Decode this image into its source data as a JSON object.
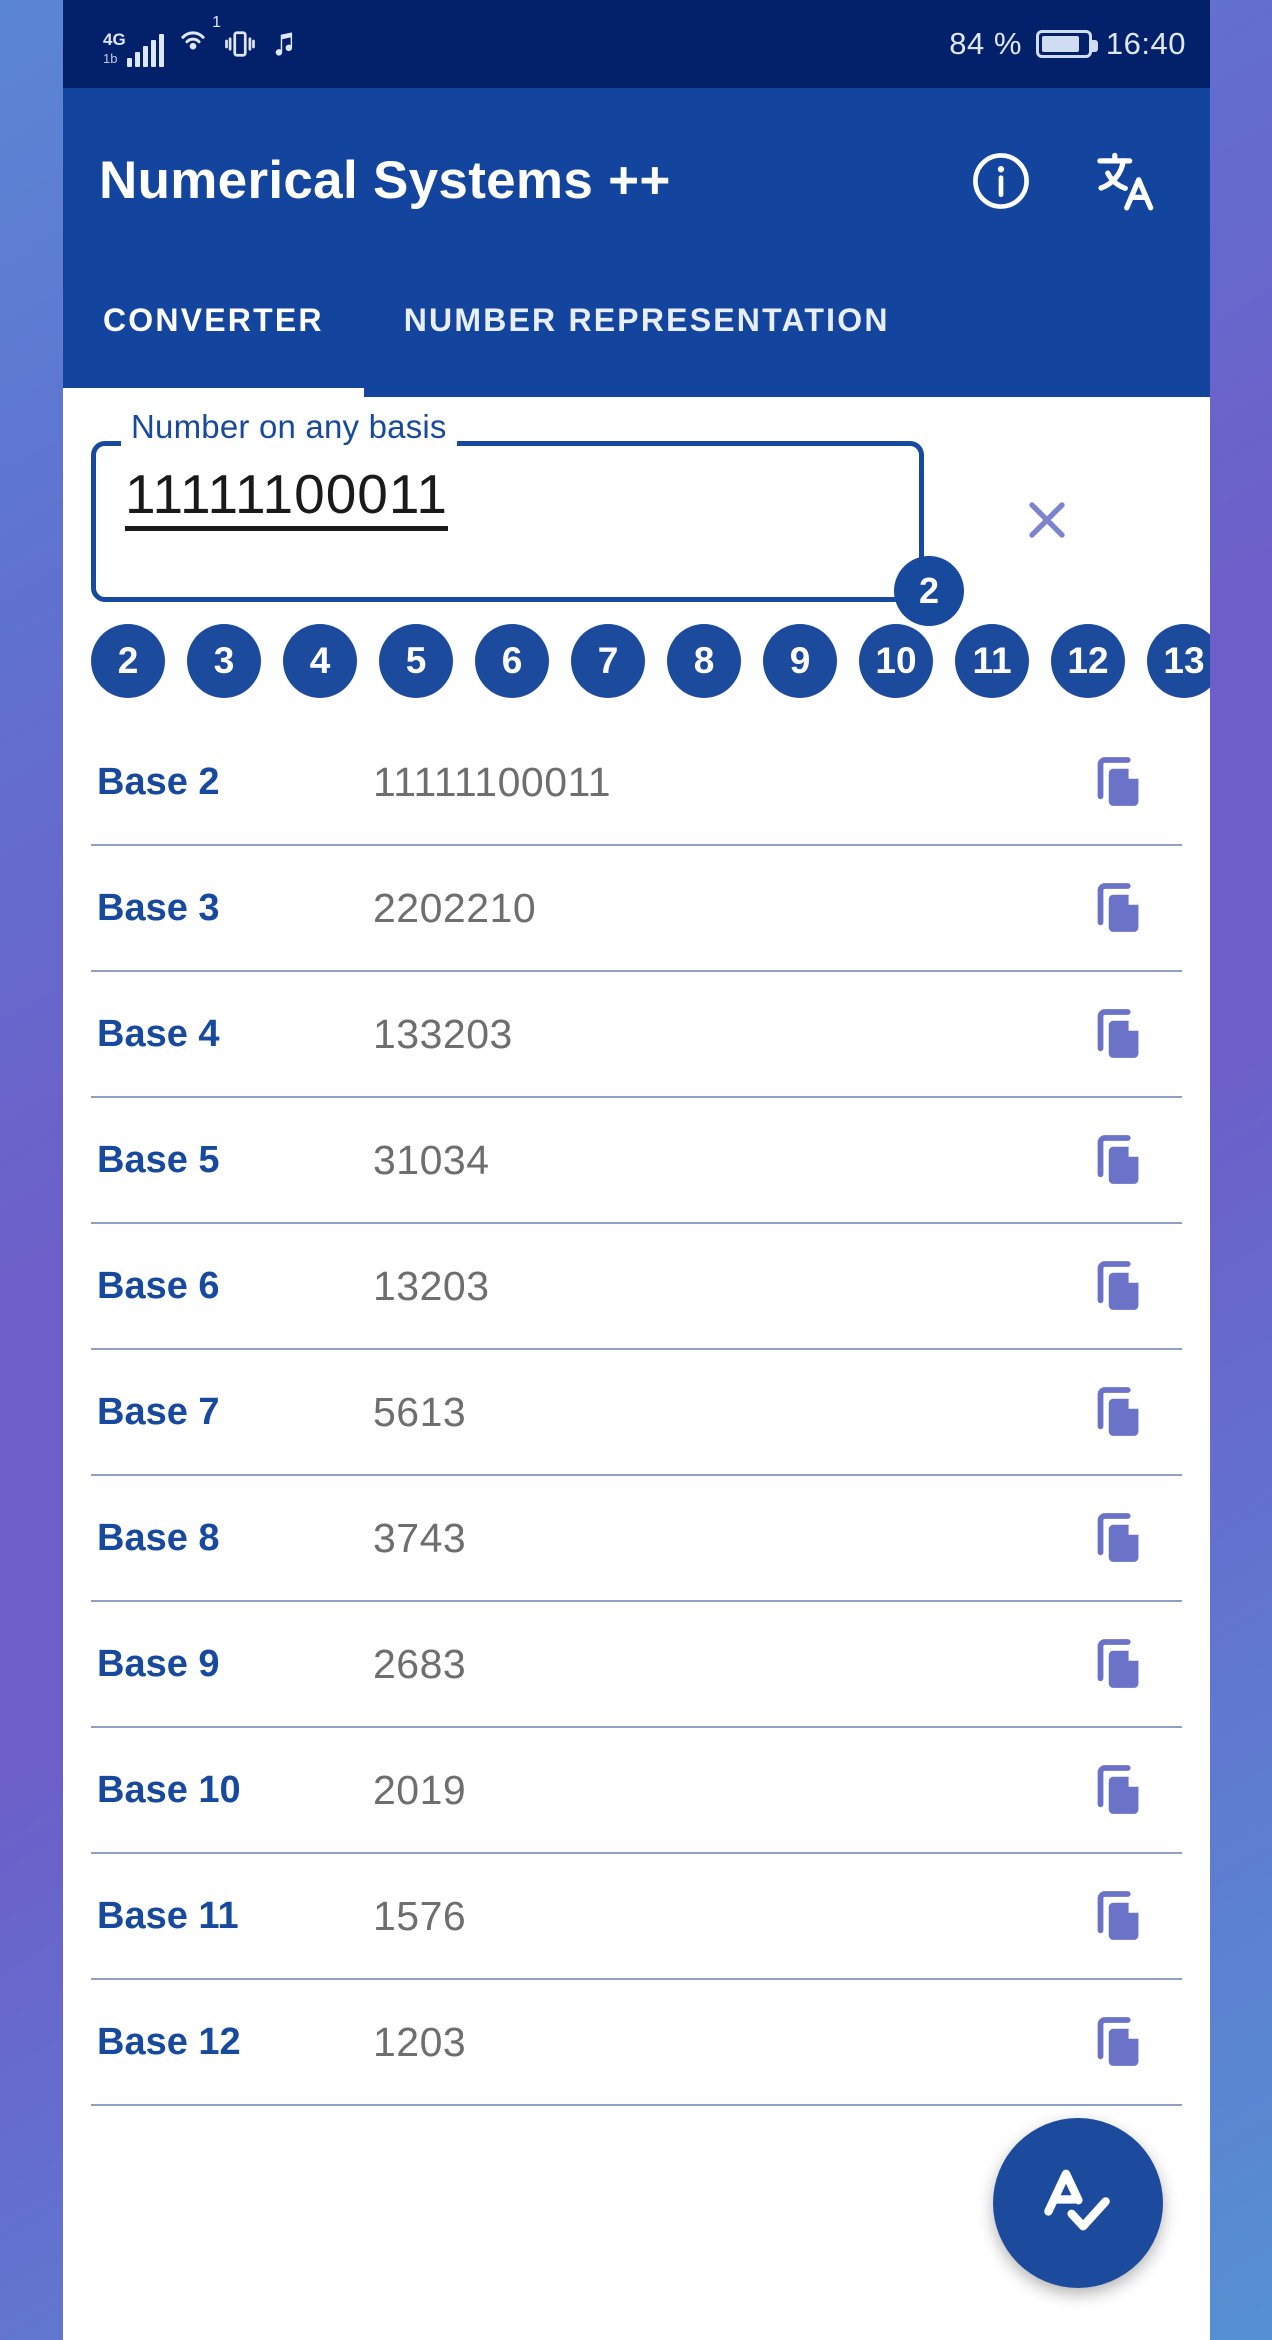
{
  "status_bar": {
    "network": "4G",
    "network_secondary": "1b",
    "hotspot_badge": "1",
    "battery_percent": "84 %",
    "time": "16:40",
    "icons": [
      "signal-icon",
      "hotspot-icon",
      "vibrate-icon",
      "music-note-icon",
      "battery-icon"
    ]
  },
  "app_bar": {
    "title": "Numerical Systems ++",
    "actions": [
      "info-icon",
      "translate-icon"
    ]
  },
  "tabs": [
    {
      "label": "CONVERTER",
      "active": true
    },
    {
      "label": "NUMBER REPRESENTATION",
      "active": false
    }
  ],
  "input_field": {
    "label": "Number on any basis",
    "value": "11111100011",
    "placeholder": "Number on any basis",
    "base_badge": "2",
    "clear_icon": "close-icon"
  },
  "base_chips": [
    "2",
    "3",
    "4",
    "5",
    "6",
    "7",
    "8",
    "9",
    "10",
    "11",
    "12",
    "13"
  ],
  "results": {
    "copy_icon": "copy-icon",
    "rows": [
      {
        "label": "Base 2",
        "value": "11111100011"
      },
      {
        "label": "Base 3",
        "value": "2202210"
      },
      {
        "label": "Base 4",
        "value": "133203"
      },
      {
        "label": "Base 5",
        "value": "31034"
      },
      {
        "label": "Base 6",
        "value": "13203"
      },
      {
        "label": "Base 7",
        "value": "5613"
      },
      {
        "label": "Base 8",
        "value": "3743"
      },
      {
        "label": "Base 9",
        "value": "2683"
      },
      {
        "label": "Base 10",
        "value": "2019"
      },
      {
        "label": "Base 11",
        "value": "1576"
      },
      {
        "label": "Base 12",
        "value": "1203"
      }
    ]
  },
  "fab": {
    "icon": "spellcheck-icon"
  },
  "colors": {
    "status_bar": "#03216b",
    "app_bar": "#14459e",
    "accent": "#174a9e",
    "chip": "#1c4b9e",
    "value_text": "#6e6e6e",
    "copy_icon": "#6b73c9",
    "clear_icon": "#7c85cc",
    "divider": "#8fa0c4",
    "background_gradient_start": "#5b86d4",
    "background_gradient_end": "#6d5fc9"
  }
}
